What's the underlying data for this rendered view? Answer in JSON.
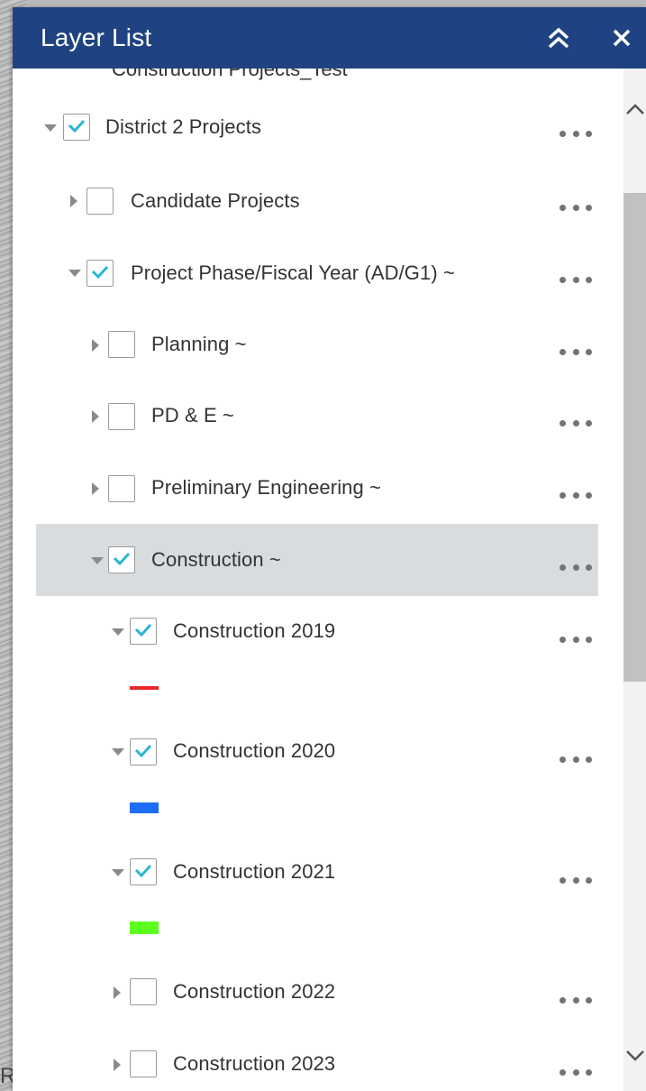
{
  "header": {
    "title": "Layer List",
    "collapse_icon": "double-chevron-up-icon",
    "close_icon": "close-icon",
    "bg_color": "#1f4382"
  },
  "cut_off_row": "Construction Projects_Test",
  "layers": [
    {
      "label": "District 2 Projects",
      "checked": true,
      "expanded": true
    },
    {
      "label": "Candidate Projects",
      "checked": false,
      "expanded": false
    },
    {
      "label": "Project Phase/Fiscal Year (AD/G1) ~",
      "checked": true,
      "expanded": true
    },
    {
      "label": "Planning ~",
      "checked": false,
      "expanded": false
    },
    {
      "label": "PD & E ~",
      "checked": false,
      "expanded": false
    },
    {
      "label": "Preliminary Engineering ~",
      "checked": false,
      "expanded": false
    },
    {
      "label": "Construction ~",
      "checked": true,
      "expanded": true,
      "selected": true
    },
    {
      "label": "Construction 2019",
      "checked": true,
      "expanded": true,
      "legend_color": "#e8262b"
    },
    {
      "label": "Construction 2020",
      "checked": true,
      "expanded": true,
      "legend_color": "#1b6ef5"
    },
    {
      "label": "Construction 2021",
      "checked": true,
      "expanded": true,
      "legend_color": "#5dff1f"
    },
    {
      "label": "Construction 2022",
      "checked": false,
      "expanded": false
    },
    {
      "label": "Construction 2023",
      "checked": false,
      "expanded": false
    }
  ],
  "colors": {
    "check_mark": "#29b6d4",
    "selected_row": "#d9dcdf"
  },
  "map_text": "RE"
}
